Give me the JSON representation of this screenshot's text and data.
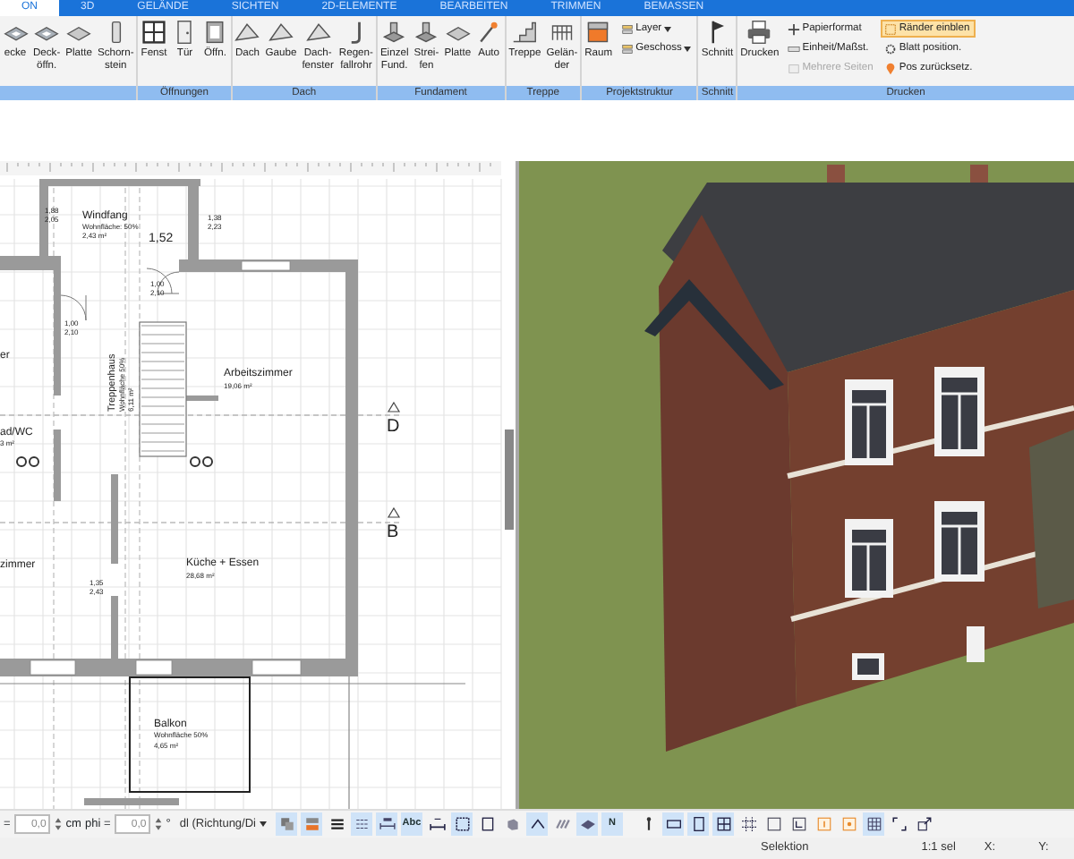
{
  "ribbon_tabs": [
    {
      "label": "ON",
      "selected": true
    },
    {
      "label": "3D",
      "selected": false
    },
    {
      "label": "GELÄNDE",
      "selected": false
    },
    {
      "label": "SICHTEN",
      "selected": false
    },
    {
      "label": "2D-ELEMENTE",
      "selected": false
    },
    {
      "label": "BEARBEITEN",
      "selected": false
    },
    {
      "label": "TRIMMEN",
      "selected": false
    },
    {
      "label": "BEMASSEN",
      "selected": false
    }
  ],
  "ribbon_groups": [
    {
      "items": [
        {
          "kind": "large",
          "lines": [
            "ecke"
          ]
        },
        {
          "kind": "large",
          "lines": [
            "Deck-",
            "öffn."
          ]
        },
        {
          "kind": "large",
          "lines": [
            "Platte"
          ]
        },
        {
          "kind": "large",
          "lines": [
            "Schorn-",
            "stein"
          ]
        }
      ]
    },
    {
      "label": "Öffnungen",
      "items": [
        {
          "kind": "large",
          "lines": [
            "Fenst"
          ]
        },
        {
          "kind": "large",
          "lines": [
            "Tür"
          ]
        },
        {
          "kind": "large",
          "lines": [
            "Öffn."
          ]
        }
      ]
    },
    {
      "label": "Dach",
      "items": [
        {
          "kind": "large",
          "lines": [
            "Dach"
          ]
        },
        {
          "kind": "large",
          "lines": [
            "Gaube"
          ]
        },
        {
          "kind": "large",
          "lines": [
            "Dach-",
            "fenster"
          ]
        },
        {
          "kind": "large",
          "lines": [
            "Regen-",
            "fallrohr"
          ]
        }
      ]
    },
    {
      "label": "Fundament",
      "items": [
        {
          "kind": "large",
          "lines": [
            "Einzel",
            "Fund."
          ]
        },
        {
          "kind": "large",
          "lines": [
            "Strei-",
            "fen"
          ]
        },
        {
          "kind": "large",
          "lines": [
            "Platte"
          ]
        },
        {
          "kind": "large",
          "lines": [
            "Auto"
          ]
        }
      ]
    },
    {
      "label": "Treppe",
      "items": [
        {
          "kind": "large",
          "lines": [
            "Treppe"
          ]
        },
        {
          "kind": "large",
          "lines": [
            "Gelän-",
            "der"
          ]
        }
      ]
    },
    {
      "label": "Projektstruktur",
      "items": [
        {
          "kind": "large",
          "lines": [
            "Raum"
          ]
        },
        {
          "kind": "column",
          "entries": [
            {
              "label": "Layer",
              "dropdown": true,
              "disabled": false,
              "selected": false
            },
            {
              "label": "Geschoss",
              "dropdown": true,
              "disabled": false,
              "selected": false
            }
          ]
        }
      ]
    },
    {
      "label": "Schnitt",
      "items": [
        {
          "kind": "large",
          "lines": [
            "Schnitt"
          ]
        }
      ]
    },
    {
      "label": "Drucken",
      "items": [
        {
          "kind": "large",
          "lines": [
            "Drucken"
          ]
        },
        {
          "kind": "column",
          "entries": [
            {
              "label": "Papierformat",
              "dropdown": false,
              "disabled": false,
              "selected": false
            },
            {
              "label": "Einheit/Maßst.",
              "dropdown": false,
              "disabled": false,
              "selected": false
            },
            {
              "label": "Mehrere Seiten",
              "dropdown": false,
              "disabled": true,
              "selected": false
            }
          ]
        },
        {
          "kind": "column",
          "entries": [
            {
              "label": "Ränder einblen",
              "dropdown": false,
              "disabled": false,
              "selected": true
            },
            {
              "label": "Blatt position.",
              "dropdown": false,
              "disabled": false,
              "selected": false
            },
            {
              "label": "Pos zurücksetz.",
              "dropdown": false,
              "disabled": false,
              "selected": false
            }
          ]
        }
      ]
    }
  ],
  "floor_plan": {
    "labels": [
      "1,52",
      "Windfang",
      "Wohnfläche: 50%",
      "2,43 m²",
      "1,88",
      "2,05",
      "1,38",
      "2,23",
      "1,00",
      "2,10",
      "1,00",
      "2,10",
      "Treppenhaus",
      "Wohnfläche 50%",
      "6,11 m²",
      "Arbeitszimmer",
      "19,06 m²",
      "er",
      "ad/WC",
      "3 m²",
      "D",
      "B",
      "zimmer",
      "Küche + Essen",
      "28,68 m²",
      "1,35",
      "2,43",
      "Balkon",
      "Wohnfläche  50%",
      "4,65 m²"
    ]
  },
  "bottom_toolbar": {
    "fields": [
      {
        "prefix": "=",
        "value": "0,0",
        "unit": "cm"
      },
      {
        "prefix": "phi =",
        "value": "0,0",
        "unit": "°"
      }
    ],
    "dropdown": "dl (Richtung/Di",
    "buttons": [
      {
        "kind": "layers",
        "selected": true
      },
      {
        "kind": "stack",
        "selected": true
      },
      {
        "kind": "lines",
        "selected": false
      },
      {
        "kind": "list",
        "selected": true
      },
      {
        "kind": "dimension",
        "selected": true
      },
      {
        "kind": "text",
        "label": "Abc",
        "selected": true
      },
      {
        "kind": "measure",
        "selected": false
      },
      {
        "kind": "frame",
        "selected": true
      },
      {
        "kind": "rect",
        "selected": false
      },
      {
        "kind": "cube",
        "selected": false
      },
      {
        "kind": "angle",
        "selected": true
      },
      {
        "kind": "hatch",
        "selected": false
      },
      {
        "kind": "slab",
        "selected": true
      },
      {
        "kind": "text",
        "label": "N",
        "selected": true
      },
      {
        "kind": "pin",
        "selected": false
      },
      {
        "kind": "wide",
        "selected": true
      },
      {
        "kind": "tall",
        "selected": true
      },
      {
        "kind": "grid",
        "selected": true
      },
      {
        "kind": "dashgrid",
        "selected": false
      },
      {
        "kind": "box",
        "selected": false
      },
      {
        "kind": "corner",
        "selected": false
      },
      {
        "kind": "orange",
        "selected": false
      },
      {
        "kind": "orangedot",
        "selected": false
      },
      {
        "kind": "densegrid",
        "selected": true
      },
      {
        "kind": "bracket",
        "selected": false
      },
      {
        "kind": "resize",
        "selected": false
      }
    ]
  },
  "status_bar": [
    "Selektion",
    "1:1 sel",
    "X:",
    "Y:"
  ]
}
